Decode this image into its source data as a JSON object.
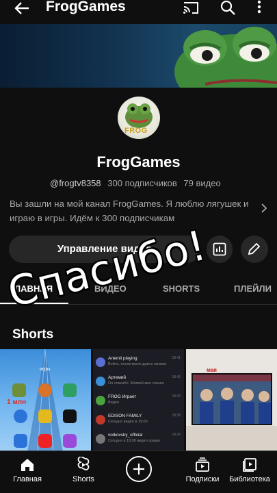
{
  "topbar": {
    "title": "FrogGames",
    "icons": [
      "back-arrow-icon",
      "cast-icon",
      "search-icon",
      "more-vert-icon"
    ]
  },
  "channel": {
    "avatar_text": "FROG",
    "name": "FrogGames",
    "handle": "@frogtv8358",
    "subscribers": "300 подписчиков",
    "videos": "79 видео",
    "description": "Вы зашли на мой канал FrogGames. Я люблю лягушек и играю в игры. Идём к 300 подписчикам"
  },
  "actions": {
    "manage_label": "Управление видео",
    "stats_icon": "analytics-icon",
    "edit_icon": "edit-pencil-icon"
  },
  "tabs": [
    {
      "label": "ГЛАВНАЯ",
      "active": true
    },
    {
      "label": "ВИДЕО",
      "active": false
    },
    {
      "label": "SHORTS",
      "active": false
    },
    {
      "label": "ПЛЕЙЛИ",
      "active": false
    }
  ],
  "overlay_text": "Спасибо!",
  "section": {
    "title": "Shorts"
  },
  "shorts": {
    "thumb1": {
      "top_label": "игры",
      "big_label": "1 млн",
      "apps": [
        "",
        "",
        "",
        "",
        "",
        "",
        "",
        "",
        ""
      ]
    },
    "thumb2": {
      "chats": [
        {
          "name": "Artemii playing",
          "msg": "Войти, посмотрели давно начали",
          "time": "18:41"
        },
        {
          "name": "Артемий",
          "msg": "Он спасибо. Матвей мне сказал",
          "time": "18:41"
        },
        {
          "name": "FROG Играет",
          "msg": "Видео",
          "time": "18:40"
        },
        {
          "name": "EDISON FAMILY",
          "msg": "Сегодня видео в 19:00",
          "time": "18:38"
        },
        {
          "name": "votkovsky_official",
          "msg": "Сегодня в 19:00 видео придет",
          "time": "18:36"
        }
      ]
    },
    "thumb3": {
      "caption": "мая"
    }
  },
  "bottom_nav": [
    {
      "label": "Главная",
      "icon": "home-icon"
    },
    {
      "label": "Shorts",
      "icon": "shorts-icon"
    },
    {
      "label": "",
      "icon": "add-circle-icon"
    },
    {
      "label": "Подписки",
      "icon": "subscriptions-icon"
    },
    {
      "label": "Библиотека",
      "icon": "library-icon"
    }
  ],
  "colors": {
    "background": "#0f0f0f",
    "button_bg": "#272727",
    "secondary_text": "#aaaaaa"
  }
}
